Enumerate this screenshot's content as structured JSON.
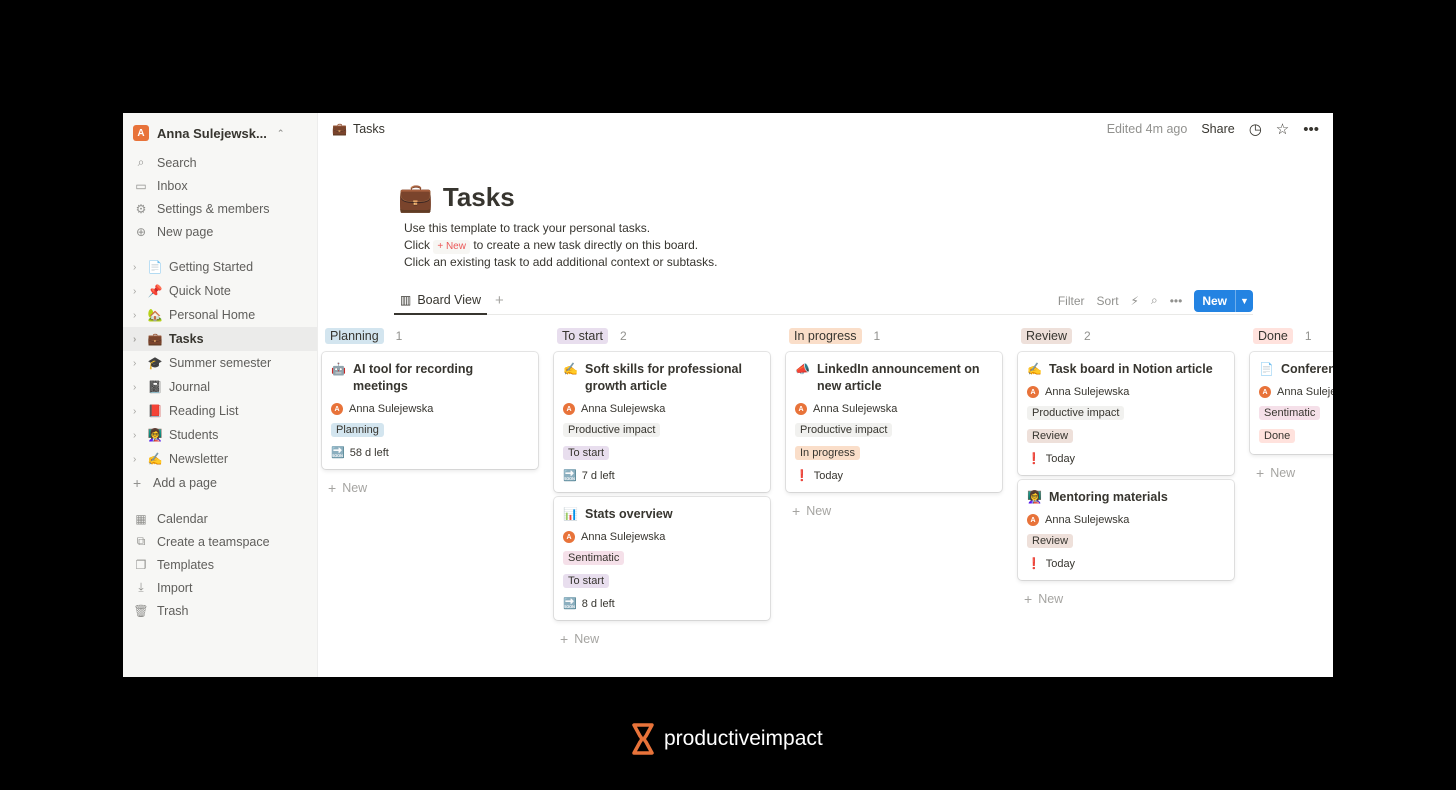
{
  "sidebar": {
    "workspace": "Anna Sulejewsk...",
    "workspace_initial": "A",
    "menu": [
      {
        "label": "Search",
        "icon": "search-icon"
      },
      {
        "label": "Inbox",
        "icon": "inbox-icon"
      },
      {
        "label": "Settings & members",
        "icon": "gear-icon"
      },
      {
        "label": "New page",
        "icon": "plus-circle-icon"
      }
    ],
    "pages": [
      {
        "label": "Getting Started",
        "emoji": "📄"
      },
      {
        "label": "Quick Note",
        "emoji": "📌"
      },
      {
        "label": "Personal Home",
        "emoji": "🏡"
      },
      {
        "label": "Tasks",
        "emoji": "💼"
      },
      {
        "label": "Summer semester",
        "emoji": "🎓"
      },
      {
        "label": "Journal",
        "emoji": "📓"
      },
      {
        "label": "Reading List",
        "emoji": "📕"
      },
      {
        "label": "Students",
        "emoji": "👩‍🏫"
      },
      {
        "label": "Newsletter",
        "emoji": "✍️"
      }
    ],
    "add_page": "Add a page",
    "bottom": [
      {
        "label": "Calendar",
        "icon": "calendar-icon"
      },
      {
        "label": "Create a teamspace",
        "icon": "teamspace-icon"
      },
      {
        "label": "Templates",
        "icon": "templates-icon"
      },
      {
        "label": "Import",
        "icon": "import-icon"
      },
      {
        "label": "Trash",
        "icon": "trash-icon"
      }
    ]
  },
  "topbar": {
    "breadcrumb": "Tasks",
    "breadcrumb_emoji": "💼",
    "edited": "Edited 4m ago",
    "share": "Share"
  },
  "page": {
    "title": "Tasks",
    "emoji": "💼",
    "desc_line1": "Use this template to track your personal tasks.",
    "desc_line2_pre": "Click",
    "desc_line2_chip": "+ New",
    "desc_line2_post": "to create a new task directly on this board.",
    "desc_line3": "Click an existing task to add additional context or subtasks."
  },
  "view": {
    "tab": "Board View",
    "filter": "Filter",
    "sort": "Sort",
    "new": "New"
  },
  "board": {
    "add_new": "New",
    "columns": [
      {
        "name": "Planning",
        "count": "1",
        "color": "#d3e5ef",
        "cards": [
          {
            "emoji": "🤖",
            "title": "AI tool for recording meetings",
            "person": "Anna Sulejewska",
            "tags": [
              {
                "label": "Planning",
                "color": "#d3e5ef"
              }
            ],
            "due_emoji": "🔜",
            "due": "58 d left"
          }
        ]
      },
      {
        "name": "To start",
        "count": "2",
        "color": "#e8deee",
        "cards": [
          {
            "emoji": "✍️",
            "title": "Soft skills for professional growth article",
            "person": "Anna Sulejewska",
            "tags": [
              {
                "label": "Productive impact",
                "color": "#f1f1ef"
              },
              {
                "label": "To start",
                "color": "#e8deee"
              }
            ],
            "due_emoji": "🔜",
            "due": "7 d left"
          },
          {
            "emoji": "📊",
            "title": "Stats overview",
            "person": "Anna Sulejewska",
            "tags": [
              {
                "label": "Sentimatic",
                "color": "#f5e0e9"
              },
              {
                "label": "To start",
                "color": "#e8deee"
              }
            ],
            "due_emoji": "🔜",
            "due": "8 d left"
          }
        ]
      },
      {
        "name": "In progress",
        "count": "1",
        "color": "#fadec9",
        "cards": [
          {
            "emoji": "📣",
            "title": "LinkedIn announcement on new article",
            "person": "Anna Sulejewska",
            "tags": [
              {
                "label": "Productive impact",
                "color": "#f1f1ef"
              },
              {
                "label": "In progress",
                "color": "#fadec9"
              }
            ],
            "due_emoji": "❗",
            "due": "Today"
          }
        ]
      },
      {
        "name": "Review",
        "count": "2",
        "color": "#eee0da",
        "cards": [
          {
            "emoji": "✍️",
            "title": "Task board in Notion article",
            "person": "Anna Sulejewska",
            "tags": [
              {
                "label": "Productive impact",
                "color": "#f1f1ef"
              },
              {
                "label": "Review",
                "color": "#eee0da"
              }
            ],
            "due_emoji": "❗",
            "due": "Today"
          },
          {
            "emoji": "👩‍🏫",
            "title": "Mentoring materials",
            "person": "Anna Sulejewska",
            "tags": [
              {
                "label": "Review",
                "color": "#eee0da"
              }
            ],
            "due_emoji": "❗",
            "due": "Today"
          }
        ]
      },
      {
        "name": "Done",
        "count": "1",
        "color": "#ffe2dd",
        "cards": [
          {
            "emoji": "📄",
            "title": "Conferenc",
            "person": "Anna Suleje",
            "tags": [
              {
                "label": "Sentimatic",
                "color": "#f5e0e9"
              },
              {
                "label": "Done",
                "color": "#ffe2dd"
              }
            ],
            "due_emoji": "",
            "due": ""
          }
        ]
      }
    ]
  },
  "brand": {
    "name": "productiveimpact",
    "color": "#e8733a"
  }
}
